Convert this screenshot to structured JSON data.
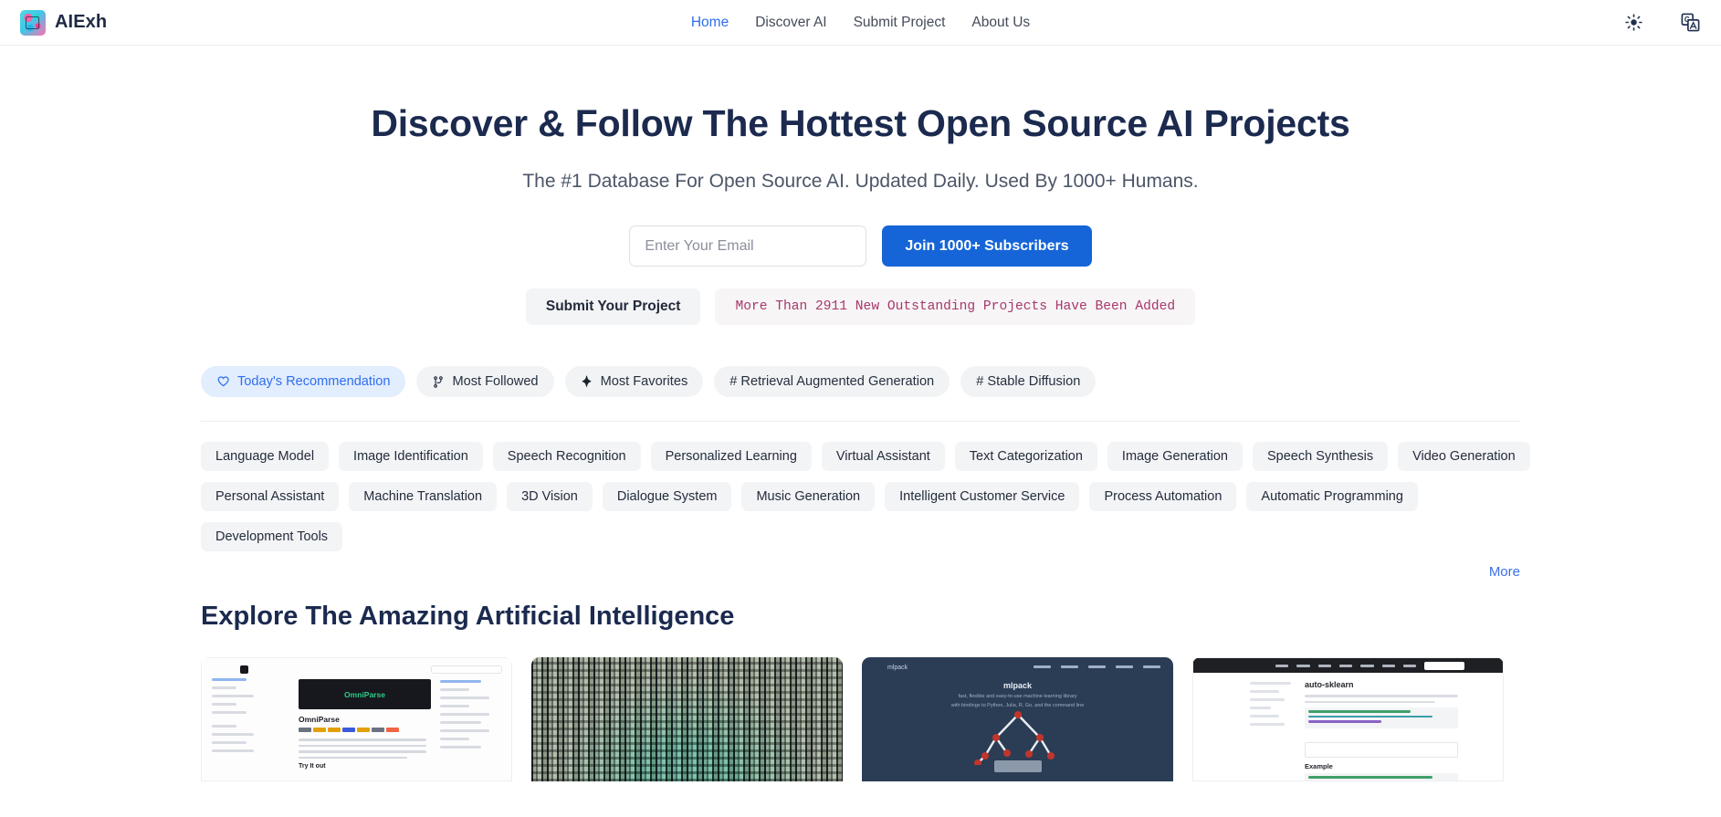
{
  "navbar": {
    "brand": "AIExh",
    "links": [
      {
        "label": "Home",
        "active": true
      },
      {
        "label": "Discover AI",
        "active": false
      },
      {
        "label": "Submit Project",
        "active": false
      },
      {
        "label": "About Us",
        "active": false
      }
    ],
    "theme_toggle_icon": "sun-icon",
    "language_icon": "translate-icon"
  },
  "hero": {
    "title": "Discover & Follow The Hottest Open Source AI Projects",
    "subtitle": "The #1 Database For Open Source AI. Updated Daily. Used By 1000+ Humans.",
    "email_placeholder": "Enter Your Email",
    "email_value": "",
    "join_button": "Join 1000+ Subscribers",
    "submit_project_button": "Submit Your Project",
    "stat_text": "More Than 2911 New Outstanding Projects Have Been Added"
  },
  "chips": [
    {
      "label": "Today's Recommendation",
      "icon": "heart-icon",
      "active": true
    },
    {
      "label": "Most Followed",
      "icon": "git-branch-icon",
      "active": false
    },
    {
      "label": "Most Favorites",
      "icon": "sparkle-icon",
      "active": false
    },
    {
      "label": "# Retrieval Augmented Generation",
      "icon": "none",
      "active": false
    },
    {
      "label": "# Stable Diffusion",
      "icon": "none",
      "active": false
    }
  ],
  "tag_rows": [
    [
      "Language Model",
      "Image Identification",
      "Speech Recognition",
      "Personalized Learning",
      "Virtual Assistant",
      "Text Categorization",
      "Image Generation",
      "Speech Synthesis",
      "Video Generation"
    ],
    [
      "Personal Assistant",
      "Machine Translation",
      "3D Vision",
      "Dialogue System",
      "Music Generation",
      "Intelligent Customer Service",
      "Process Automation",
      "Automatic Programming"
    ],
    [
      "Development Tools"
    ]
  ],
  "more_link": "More",
  "section_title": "Explore The Amazing Artificial Intelligence",
  "cards": [
    {
      "name": "OmniParse",
      "thumb": "docs-screenshot",
      "heading": "OmniParse",
      "subheading": "Try It out"
    },
    {
      "name": "circuit-artwork",
      "thumb": "circuit-art"
    },
    {
      "name": "mlpack",
      "thumb": "mlpack-landing",
      "title": "mlpack",
      "sub1": "fast, flexible and easy-to-use machine learning library",
      "sub2": "with bindings to Python, Julia, R, Go, and the command line"
    },
    {
      "name": "auto-sklearn",
      "thumb": "sklearn-docs",
      "heading": "auto-sklearn",
      "subheading": "Example"
    }
  ],
  "colors": {
    "accent_blue": "#2f6ef0",
    "button_blue": "#1565d8",
    "heading_navy": "#1b2a4e",
    "stat_maroon": "#a8376b",
    "chip_bg": "#f2f3f5",
    "chip_active_bg": "#e2edfd"
  }
}
